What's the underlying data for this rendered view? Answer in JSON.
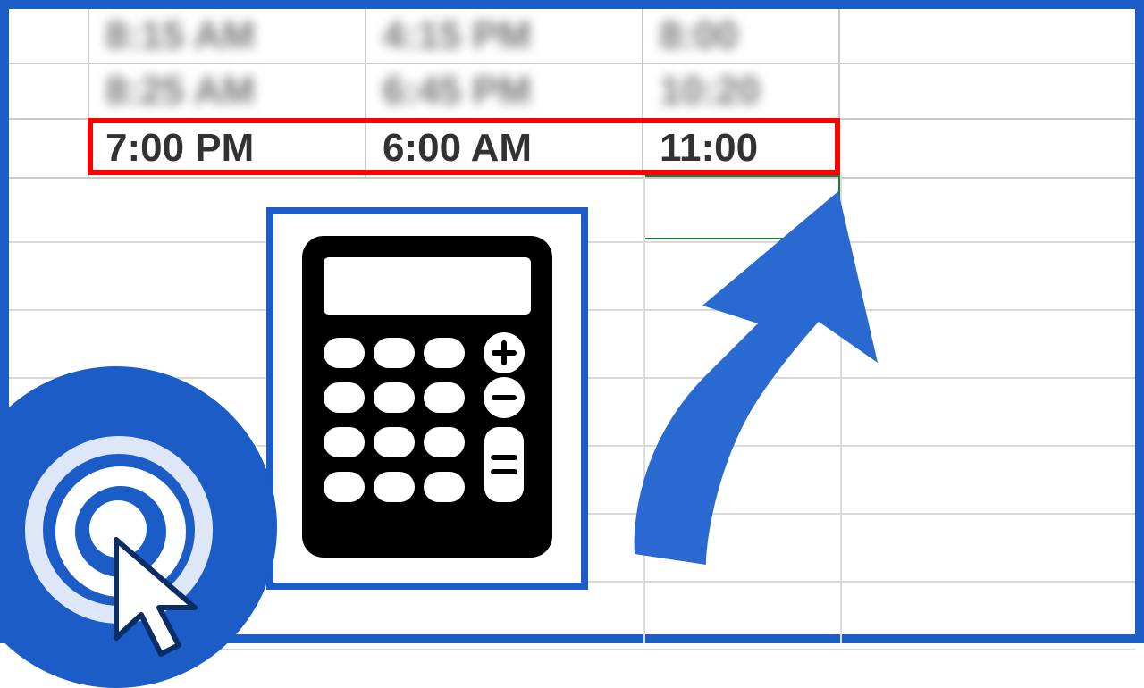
{
  "table": {
    "rows_blurred": [
      {
        "start": "8:15 AM",
        "end": "4:15 PM",
        "total": "8:00"
      },
      {
        "start": "8:25 AM",
        "end": "6:45 PM",
        "total": "10:20"
      }
    ],
    "highlighted": {
      "start": "7:00 PM",
      "end": "6:00 AM",
      "total": "11:00"
    }
  },
  "icons": {
    "calculator": "calculator-icon",
    "arrow": "arrow-up-right-icon",
    "cursor": "cursor-icon"
  },
  "colors": {
    "frame": "#1b5cc7",
    "highlight": "#ff0000",
    "cell_selection": "#1f7a3a"
  }
}
